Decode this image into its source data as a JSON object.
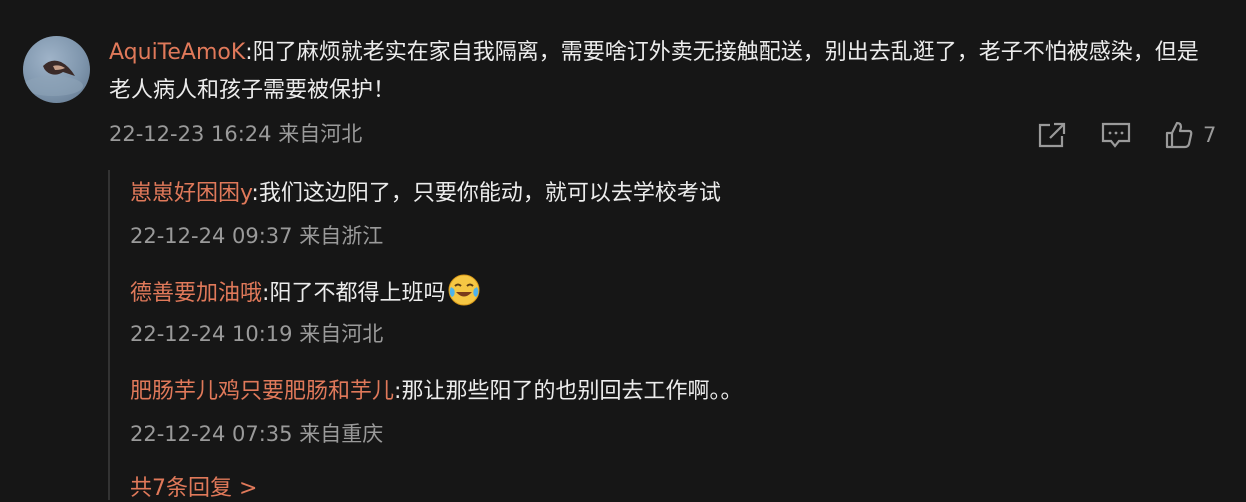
{
  "comment": {
    "author": "AquiTeAmoK",
    "separator": ":",
    "text": "阳了麻烦就老实在家自我隔离，需要啥订外卖无接触配送，别出去乱逛了，老子不怕被感染，但是老人病人和孩子需要被保护！",
    "timestamp": "22-12-23 16:24",
    "location": "来自河北",
    "like_count": "7",
    "icons": [
      "share-icon",
      "comment-icon",
      "like-icon"
    ]
  },
  "replies": [
    {
      "author": "崽崽好困困y",
      "separator": ":",
      "text": "我们这边阳了，只要你能动，就可以去学校考试",
      "timestamp": "22-12-24 09:37",
      "location": "来自浙江"
    },
    {
      "author": "德善要加油哦",
      "separator": ":",
      "text": "阳了不都得上班吗",
      "emoji": "crying-laughing-emoji",
      "timestamp": "22-12-24 10:19",
      "location": "来自河北"
    },
    {
      "author": "肥肠芋儿鸡只要肥肠和芋儿",
      "separator": ":",
      "text": "那让那些阳了的也别回去工作啊。。",
      "timestamp": "22-12-24 07:35",
      "location": "来自重庆"
    }
  ],
  "more_replies": "共7条回复 >",
  "colors": {
    "background": "#161616",
    "author": "#e0795a",
    "text": "#ececec",
    "meta": "#9a9a9a"
  }
}
